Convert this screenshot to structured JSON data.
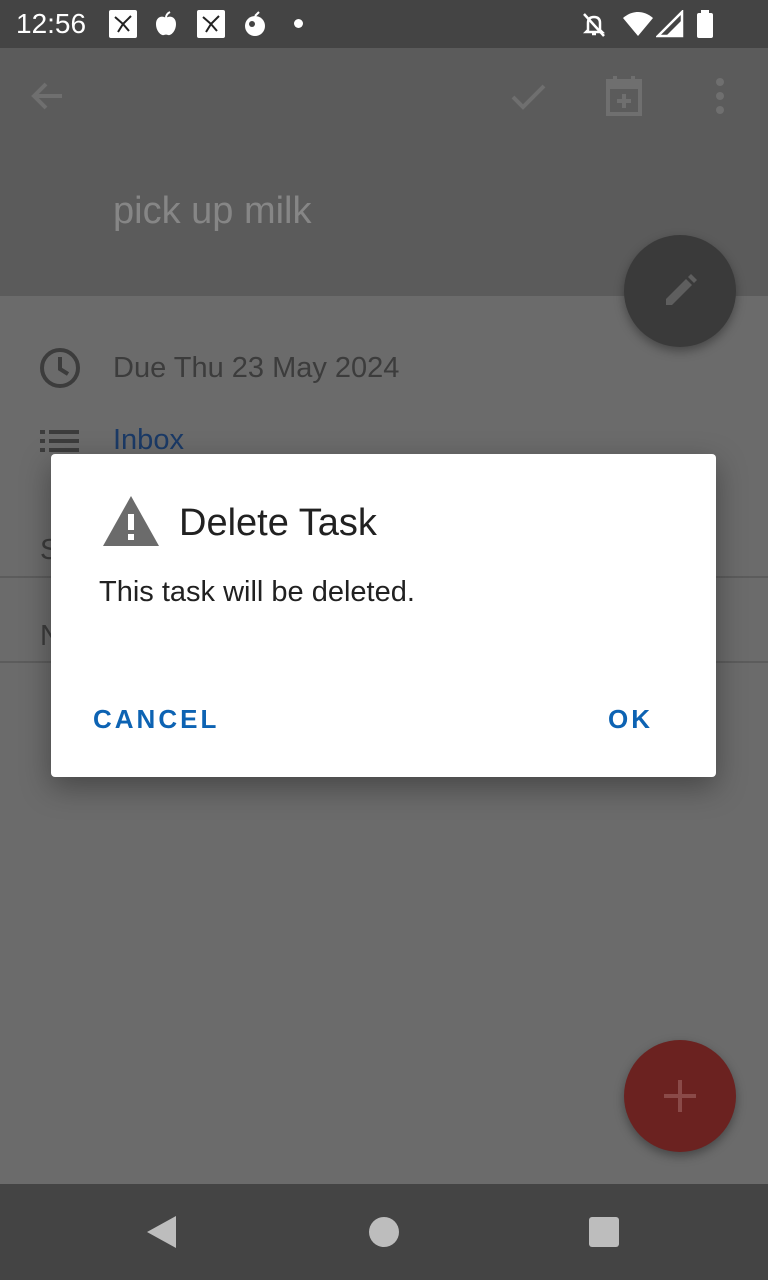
{
  "status_bar": {
    "time": "12:56",
    "notification_icons": [
      "app-icon",
      "apple-icon",
      "app-icon",
      "fruit-icon",
      "dot-icon"
    ],
    "system_icons": [
      "notifications-off-icon",
      "wifi-icon",
      "signal-icon",
      "battery-icon"
    ]
  },
  "app_bar": {
    "title": "pick up milk",
    "actions": [
      "back-arrow-icon",
      "checkmark-icon",
      "calendar-add-icon",
      "more-vert-icon"
    ]
  },
  "task": {
    "due": "Due Thu 23 May 2024",
    "list": "Inbox",
    "row3_initial": "S",
    "row4_initial": "N"
  },
  "dialog": {
    "title": "Delete Task",
    "message": "This task will be deleted.",
    "cancel_label": "CANCEL",
    "ok_label": "OK"
  },
  "colors": {
    "accent": "#0d63b3",
    "list_link": "#1b3a66",
    "fab_add": "#6b2220"
  }
}
